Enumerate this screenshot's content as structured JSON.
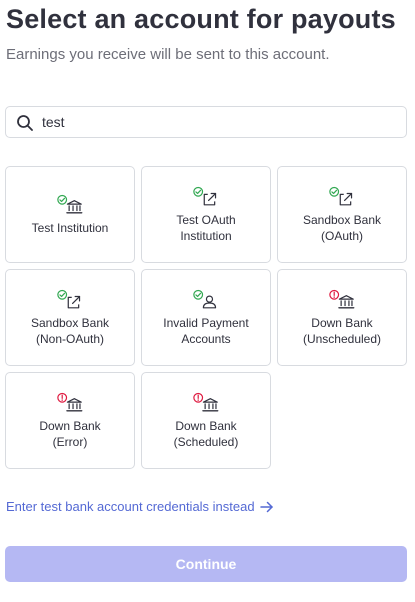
{
  "header": {
    "title": "Select an account for payouts",
    "subtitle": "Earnings you receive will be sent to this account."
  },
  "search": {
    "value": "test",
    "icon": "search-icon"
  },
  "institutions": [
    {
      "label": "Test Institution",
      "icon": "bank-icon",
      "status": "check"
    },
    {
      "label": "Test OAuth\nInstitution",
      "icon": "external-link-icon",
      "status": "check"
    },
    {
      "label": "Sandbox Bank\n(OAuth)",
      "icon": "external-link-icon",
      "status": "check"
    },
    {
      "label": "Sandbox Bank\n(Non-OAuth)",
      "icon": "external-link-icon",
      "status": "check"
    },
    {
      "label": "Invalid Payment\nAccounts",
      "icon": "user-icon",
      "status": "check"
    },
    {
      "label": "Down Bank\n(Unscheduled)",
      "icon": "bank-icon",
      "status": "error"
    },
    {
      "label": "Down Bank\n(Error)",
      "icon": "bank-icon",
      "status": "error"
    },
    {
      "label": "Down Bank\n(Scheduled)",
      "icon": "bank-icon",
      "status": "error"
    }
  ],
  "manual_link": {
    "label": "Enter test bank account credentials instead",
    "icon": "arrow-right-icon"
  },
  "continue_button": {
    "label": "Continue",
    "enabled": false
  },
  "colors": {
    "check": "#32a852",
    "error": "#df1b41",
    "link": "#5469d4",
    "button_disabled": "#b5b8f3"
  }
}
